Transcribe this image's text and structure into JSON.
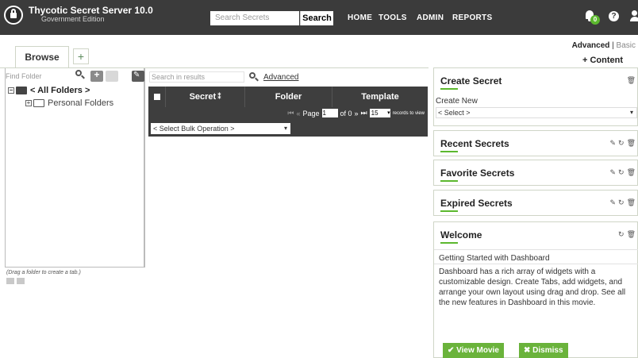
{
  "app": {
    "title": "Thycotic Secret Server 10.0",
    "subtitle": "Government Edition"
  },
  "header": {
    "search_placeholder": "Search Secrets",
    "search_button": "Search",
    "nav": [
      "HOME",
      "TOOLS",
      "ADMIN",
      "REPORTS"
    ],
    "notification_count": "0",
    "help_label": "?"
  },
  "view_mode": {
    "advanced": "Advanced",
    "separator": "|",
    "basic": "Basic"
  },
  "content_button": "+ Content",
  "tabs": {
    "browse": "Browse",
    "add": "+"
  },
  "folders": {
    "find_placeholder": "Find Folder",
    "all_folders": "< All Folders >",
    "items": [
      "Personal Folders"
    ],
    "drag_note": "(Drag a folder to create a tab.)"
  },
  "grid": {
    "search_placeholder": "Search in results",
    "advanced_link": "Advanced",
    "columns": [
      "Secret",
      "Folder",
      "Template"
    ],
    "page_label": "Page",
    "page_value": "1",
    "of_label": "of 0",
    "per_page": "15",
    "records_label": "records to view",
    "bulk_operation": "< Select Bulk Operation >"
  },
  "widgets": {
    "create_secret": {
      "title": "Create Secret",
      "create_new_label": "Create New",
      "select_value": "< Select >"
    },
    "recent_secrets": {
      "title": "Recent Secrets"
    },
    "favorite_secrets": {
      "title": "Favorite Secrets"
    },
    "expired_secrets": {
      "title": "Expired Secrets"
    },
    "welcome": {
      "title": "Welcome",
      "subtitle": "Getting Started with Dashboard",
      "text": "Dashboard has a rich array of widgets with a customizable design. Create Tabs, add widgets, and arrange your own layout using drag and drop. See all the new features in Dashboard in this movie.",
      "view_movie": "✔ View Movie",
      "dismiss": "✖ Dismiss"
    }
  },
  "colors": {
    "topbar": "#3b3b3b",
    "accent_green": "#5cb82e",
    "button_green": "#6ab33b",
    "grid_header": "#3e3e3e"
  }
}
